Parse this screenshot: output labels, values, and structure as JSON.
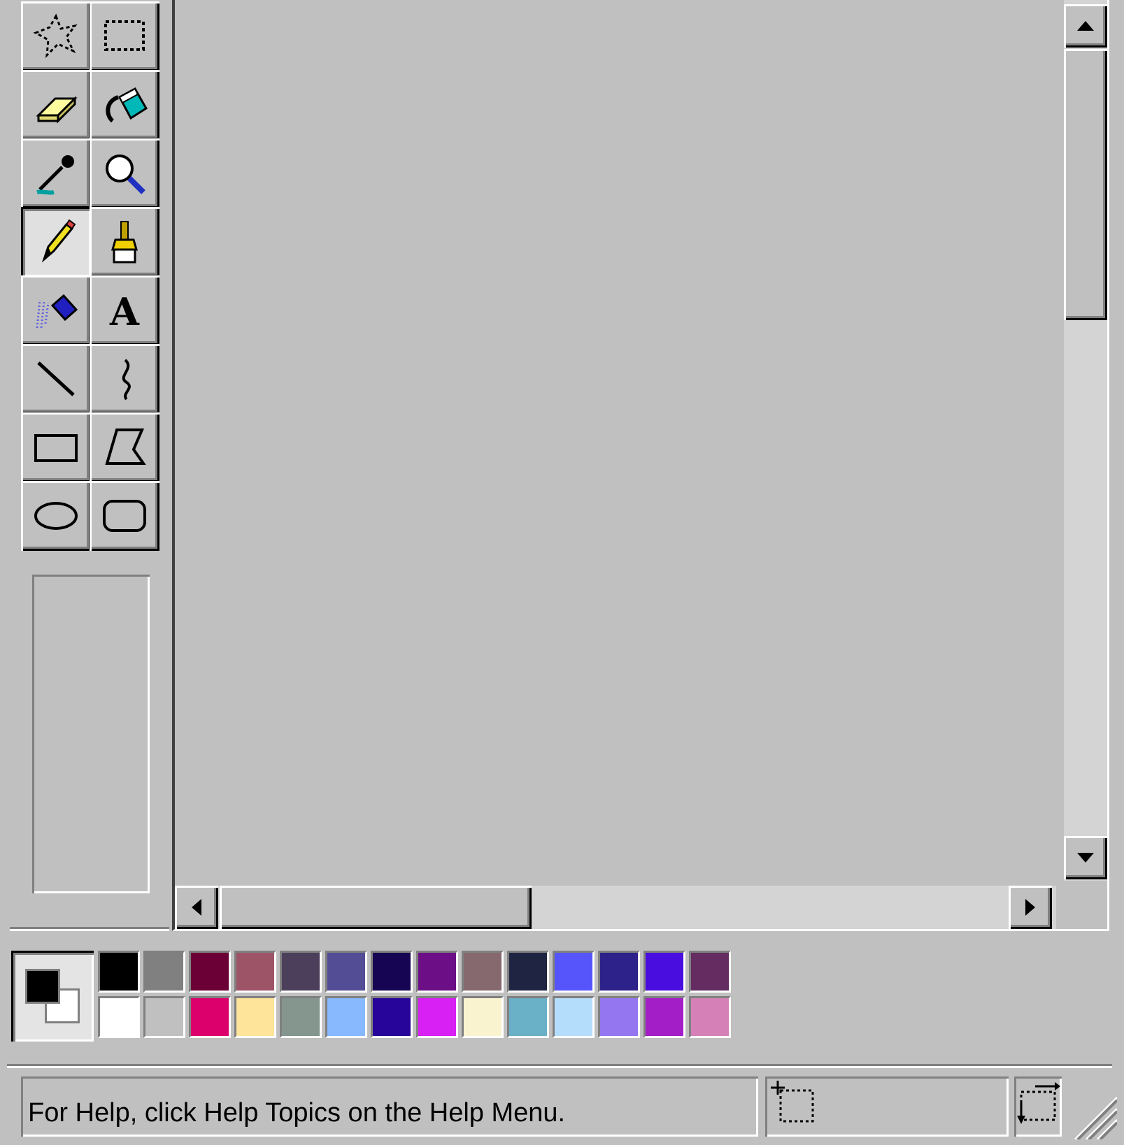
{
  "toolbox": {
    "tools": [
      {
        "icon": "free-form-select-icon"
      },
      {
        "icon": "rectangle-select-icon"
      },
      {
        "icon": "eraser-icon"
      },
      {
        "icon": "fill-bucket-icon"
      },
      {
        "icon": "color-picker-icon"
      },
      {
        "icon": "magnifier-icon"
      },
      {
        "icon": "pencil-icon",
        "active": true
      },
      {
        "icon": "brush-icon"
      },
      {
        "icon": "airbrush-icon"
      },
      {
        "icon": "text-tool-icon",
        "glyph": "A"
      },
      {
        "icon": "line-icon"
      },
      {
        "icon": "curve-icon"
      },
      {
        "icon": "rectangle-icon"
      },
      {
        "icon": "polygon-icon"
      },
      {
        "icon": "ellipse-icon"
      },
      {
        "icon": "rounded-rectangle-icon"
      }
    ]
  },
  "colors": {
    "foreground": "#000000",
    "background": "#ffffff",
    "palette_top": [
      "#000000",
      "#808080",
      "#6b0037",
      "#9e5467",
      "#4b3f5c",
      "#524d95",
      "#150552",
      "#6c0e86",
      "#86696e",
      "#202443",
      "#5555fb",
      "#2c2289",
      "#4a0ddf",
      "#642c60"
    ],
    "palette_bottom": [
      "#ffffff",
      "#c0c0c0",
      "#dc006c",
      "#fde49a",
      "#84968d",
      "#88b8fd",
      "#28059a",
      "#d820f4",
      "#faf3d0",
      "#6ab0c6",
      "#b4ddfb",
      "#9476f1",
      "#a31ec7",
      "#d581b7"
    ]
  },
  "status_bar": {
    "help_text": "For Help, click Help Topics on the Help Menu.",
    "position_icon": "cursor-position-icon",
    "size_icon": "selection-size-icon"
  }
}
